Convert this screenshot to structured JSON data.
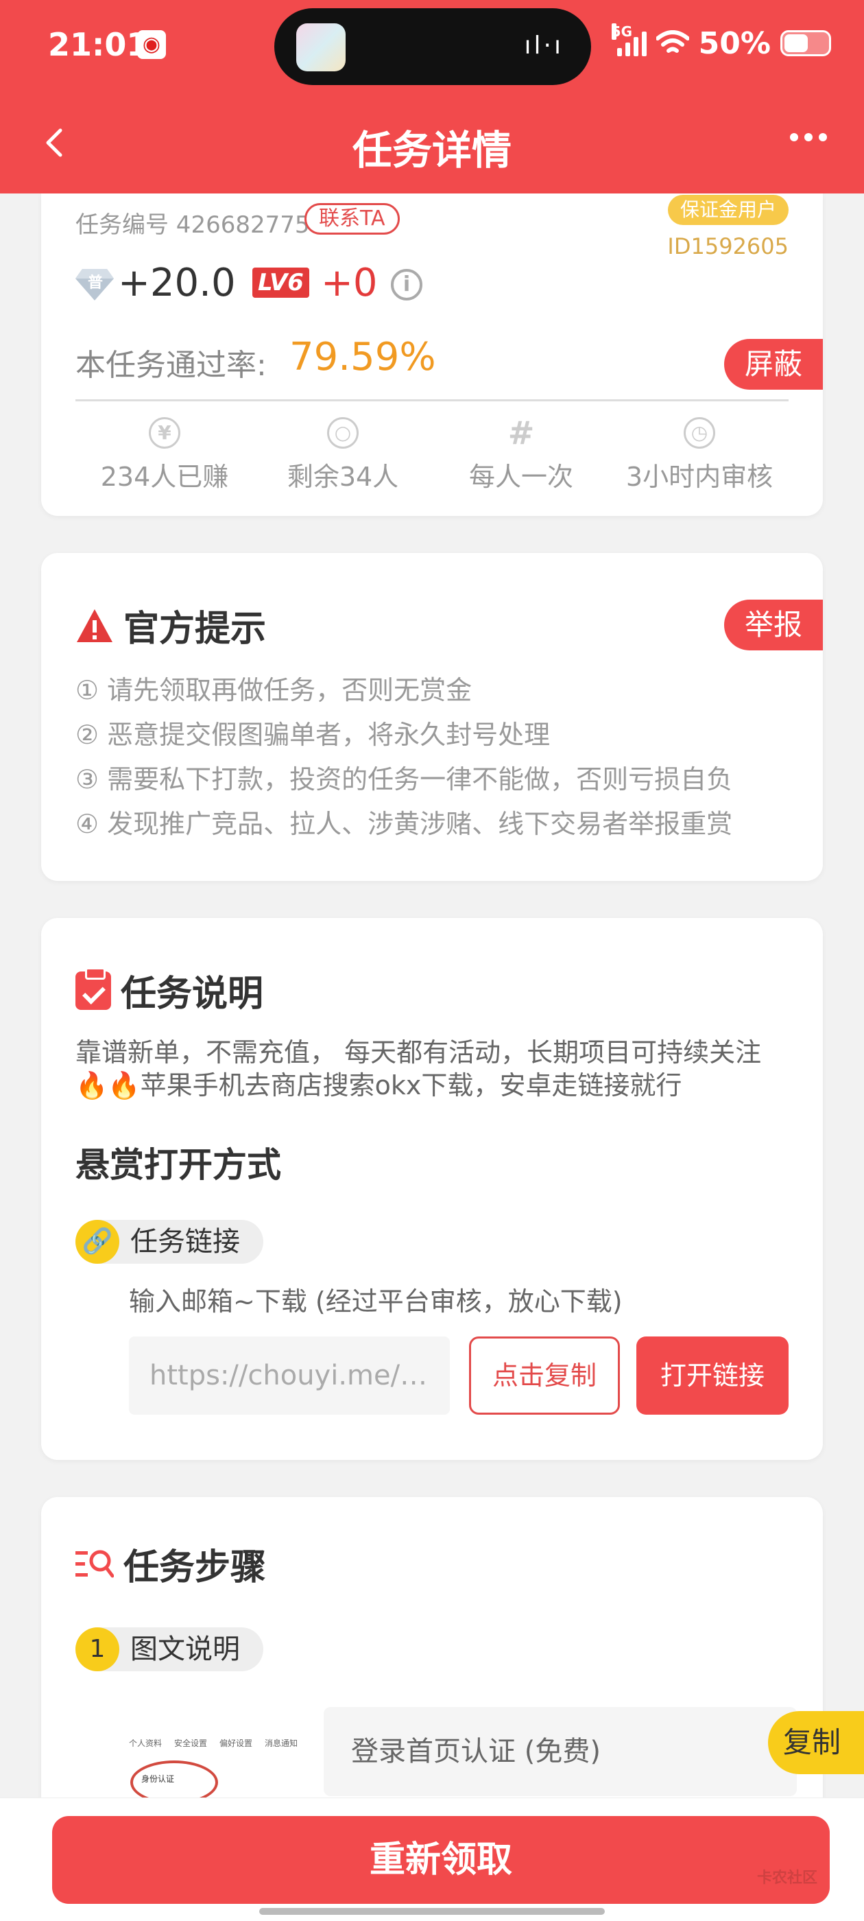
{
  "status_bar": {
    "time": "21:01",
    "network": "5G",
    "battery": "50%"
  },
  "nav": {
    "title": "任务详情"
  },
  "task_card": {
    "task_id": "任务编号 426682775",
    "contact_label": "联系TA",
    "deposit_badge": "保证金用户",
    "user_id": "ID1592605",
    "gem_label": "普",
    "reward": "+20.0",
    "level_badge": "LV6",
    "level_bonus": "+0",
    "pass_rate_label": "本任务通过率:",
    "pass_rate": "79.59%",
    "block_label": "屏蔽",
    "stats": [
      {
        "icon": "yuan-icon",
        "glyph": "¥",
        "label": "234人已赚"
      },
      {
        "icon": "person-icon",
        "glyph": "○",
        "label": "剩余34人"
      },
      {
        "icon": "hash-icon",
        "glyph": "#",
        "label": "每人一次"
      },
      {
        "icon": "clock-icon",
        "glyph": "◷",
        "label": "3小时内审核"
      }
    ]
  },
  "notice": {
    "title": "官方提示",
    "report_label": "举报",
    "items": [
      "① 请先领取再做任务，否则无赏金",
      "② 恶意提交假图骗单者，将永久封号处理",
      "③ 需要私下打款，投资的任务一律不能做，否则亏损自负",
      "④ 发现推广竞品、拉人、涉黄涉赌、线下交易者举报重赏"
    ]
  },
  "description": {
    "title": "任务说明",
    "line1": "靠谱新单，不需充值， 每天都有活动，长期项目可持续关注",
    "line2": "🔥🔥苹果手机去商店搜索okx下载，安卓走链接就行",
    "open_method_title": "悬赏打开方式",
    "link_chip_label": "任务链接",
    "link_hint": "输入邮箱~下载 (经过平台审核，放心下载)",
    "url": "https://chouyi.me/j…",
    "copy_label": "点击复制",
    "open_label": "打开链接"
  },
  "steps": {
    "title": "任务步骤",
    "step_number": "1",
    "step_label": "图文说明",
    "thumb_tabs": [
      "个人资料",
      "安全设置",
      "偏好设置",
      "消息通知"
    ],
    "thumb_text": "身份认证",
    "step_text": "登录首页认证 (免费)",
    "copy_float_label": "复制"
  },
  "bottom": {
    "reclaim_label": "重新领取",
    "watermark": "卡农社区"
  },
  "colors": {
    "primary": "#f24a4c",
    "accent_yellow": "#f8cc1b",
    "pass_rate": "#f19a22"
  }
}
